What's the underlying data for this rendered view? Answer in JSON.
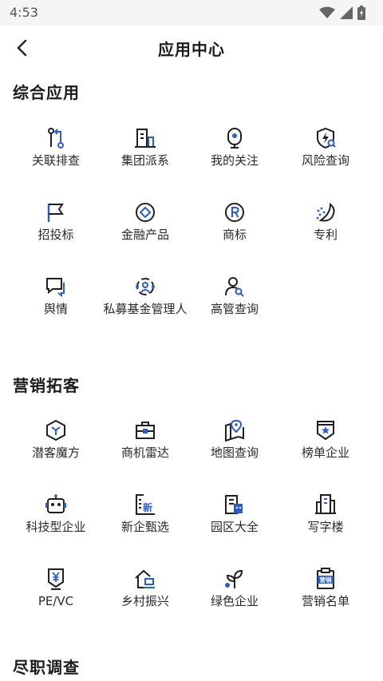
{
  "status_bar": {
    "time": "4:53"
  },
  "header": {
    "title": "应用中心"
  },
  "sections": [
    {
      "title": "综合应用",
      "items": [
        {
          "label": "关联排查",
          "icon": "relation-check-icon"
        },
        {
          "label": "集团派系",
          "icon": "group-building-icon"
        },
        {
          "label": "我的关注",
          "icon": "follow-icon"
        },
        {
          "label": "风险查询",
          "icon": "risk-shield-icon"
        },
        {
          "label": "招投标",
          "icon": "bidding-flag-icon"
        },
        {
          "label": "金融产品",
          "icon": "finance-coin-icon"
        },
        {
          "label": "商标",
          "icon": "trademark-icon"
        },
        {
          "label": "专利",
          "icon": "patent-icon"
        },
        {
          "label": "舆情",
          "icon": "public-opinion-icon"
        },
        {
          "label": "私募基金管理人",
          "icon": "private-fund-icon"
        },
        {
          "label": "高管查询",
          "icon": "executive-search-icon"
        }
      ]
    },
    {
      "title": "营销拓客",
      "items": [
        {
          "label": "潜客魔方",
          "icon": "cube-icon"
        },
        {
          "label": "商机雷达",
          "icon": "briefcase-icon"
        },
        {
          "label": "地图查询",
          "icon": "map-pin-icon"
        },
        {
          "label": "榜单企业",
          "icon": "ranking-badge-icon"
        },
        {
          "label": "科技型企业",
          "icon": "robot-icon"
        },
        {
          "label": "新企甄选",
          "icon": "new-company-icon"
        },
        {
          "label": "园区大全",
          "icon": "park-building-icon"
        },
        {
          "label": "写字楼",
          "icon": "office-building-icon"
        },
        {
          "label": "PE/VC",
          "icon": "yuan-shield-icon"
        },
        {
          "label": "乡村振兴",
          "icon": "rural-house-icon"
        },
        {
          "label": "绿色企业",
          "icon": "sprout-icon"
        },
        {
          "label": "营销名单",
          "icon": "marketing-clipboard-icon",
          "badge": "营销"
        }
      ]
    },
    {
      "title": "尽职调查",
      "items": []
    }
  ],
  "colors": {
    "accent": "#2a5bd7",
    "icon_dark": "#1f1f1f"
  }
}
